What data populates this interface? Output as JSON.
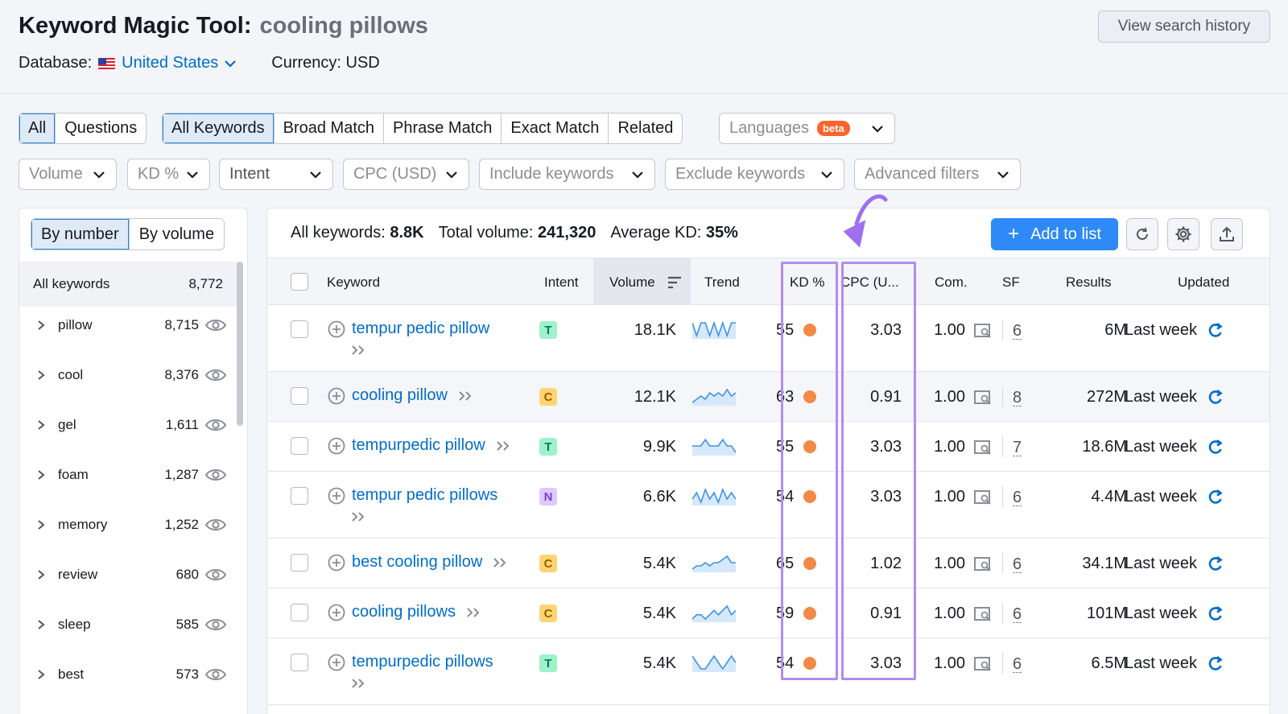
{
  "header": {
    "tool_title": "Keyword Magic Tool:",
    "query": "cooling pillows",
    "history_button": "View search history",
    "database_label": "Database:",
    "database_value": "United States",
    "currency": "Currency: USD"
  },
  "match_tabs": {
    "type_tabs": [
      "All",
      "Questions"
    ],
    "match_options": [
      "All Keywords",
      "Broad Match",
      "Phrase Match",
      "Exact Match",
      "Related"
    ],
    "languages": "Languages",
    "beta": "beta"
  },
  "filters": [
    "Volume",
    "KD %",
    "Intent",
    "CPC (USD)",
    "Include keywords",
    "Exclude keywords",
    "Advanced filters"
  ],
  "groups_panel": {
    "toggle": [
      "By number",
      "By volume"
    ],
    "all_label": "All keywords",
    "all_count": "8,772",
    "groups": [
      {
        "label": "pillow",
        "count": "8,715"
      },
      {
        "label": "cool",
        "count": "8,376"
      },
      {
        "label": "gel",
        "count": "1,611"
      },
      {
        "label": "foam",
        "count": "1,287"
      },
      {
        "label": "memory",
        "count": "1,252"
      },
      {
        "label": "review",
        "count": "680"
      },
      {
        "label": "sleep",
        "count": "585"
      },
      {
        "label": "best",
        "count": "573"
      }
    ]
  },
  "summary": {
    "all_label": "All keywords:",
    "all_value": "8.8K",
    "volume_label": "Total volume:",
    "volume_value": "241,320",
    "kd_label": "Average KD:",
    "kd_value": "35%",
    "add_button": "Add to list"
  },
  "table": {
    "columns": [
      "Keyword",
      "Intent",
      "Volume",
      "Trend",
      "KD %",
      "CPC (U...",
      "Com.",
      "SF",
      "Results",
      "Updated"
    ],
    "rows": [
      {
        "keyword": "tempur pedic pillow",
        "intent": "T",
        "volume": "18.1K",
        "kd": "55",
        "cpc": "3.03",
        "com": "1.00",
        "sf": "6",
        "results": "6M",
        "updated": "Last week",
        "trend": [
          6,
          5,
          6,
          6,
          5,
          6,
          5,
          6,
          5,
          6,
          6
        ]
      },
      {
        "keyword": "cooling pillow",
        "intent": "C",
        "volume": "12.1K",
        "kd": "63",
        "cpc": "0.91",
        "com": "1.00",
        "sf": "8",
        "results": "272M",
        "updated": "Last week",
        "trend": [
          3,
          4,
          5,
          4,
          6,
          5,
          6,
          5,
          7,
          5,
          6
        ]
      },
      {
        "keyword": "tempurpedic pillow",
        "intent": "T",
        "volume": "9.9K",
        "kd": "55",
        "cpc": "3.03",
        "com": "1.00",
        "sf": "7",
        "results": "18.6M",
        "updated": "Last week",
        "trend": [
          2,
          2,
          2,
          3,
          2,
          2,
          2,
          3,
          2,
          2,
          1
        ]
      },
      {
        "keyword": "tempur pedic pillows",
        "intent": "N",
        "volume": "6.6K",
        "kd": "54",
        "cpc": "3.03",
        "com": "1.00",
        "sf": "6",
        "results": "4.4M",
        "updated": "Last week",
        "trend": [
          4,
          6,
          3,
          7,
          4,
          6,
          3,
          7,
          4,
          6,
          4
        ]
      },
      {
        "keyword": "best cooling pillow",
        "intent": "C",
        "volume": "5.4K",
        "kd": "65",
        "cpc": "1.02",
        "com": "1.00",
        "sf": "6",
        "results": "34.1M",
        "updated": "Last week",
        "trend": [
          2,
          3,
          3,
          4,
          3,
          4,
          4,
          5,
          6,
          4,
          4
        ]
      },
      {
        "keyword": "cooling pillows",
        "intent": "C",
        "volume": "5.4K",
        "kd": "59",
        "cpc": "0.91",
        "com": "1.00",
        "sf": "6",
        "results": "101M",
        "updated": "Last week",
        "trend": [
          2,
          3,
          3,
          2,
          3,
          4,
          3,
          4,
          5,
          3,
          4
        ]
      },
      {
        "keyword": "tempurpedic pillows",
        "intent": "T",
        "volume": "5.4K",
        "kd": "54",
        "cpc": "3.03",
        "com": "1.00",
        "sf": "6",
        "results": "6.5M",
        "updated": "Last week",
        "trend": [
          5,
          4,
          3,
          3,
          4,
          5,
          4,
          3,
          4,
          5,
          4
        ]
      }
    ]
  },
  "colors": {
    "link": "#006dca",
    "accent": "#2e8af6",
    "kd_dot": "#f28a45",
    "highlight": "#b28cf0",
    "beta": "#ff642d"
  },
  "icons": [
    "chevron-down-icon",
    "refresh-icon",
    "settings-gear-icon",
    "export-icon",
    "eye-icon",
    "plus-circle-icon",
    "double-chevron-icon",
    "serp-icon",
    "sort-icon",
    "arrow-annotation"
  ]
}
